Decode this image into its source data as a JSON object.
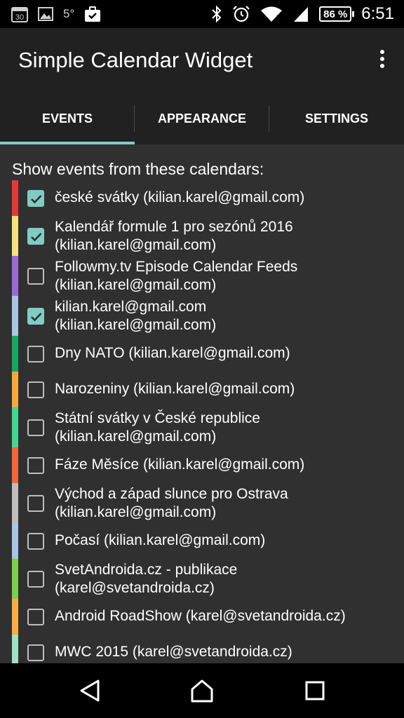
{
  "status_bar": {
    "calendar_day": "30",
    "temperature": "5°",
    "battery": "86 %",
    "time": "6:51"
  },
  "app": {
    "title": "Simple Calendar Widget"
  },
  "tabs": [
    {
      "label": "EVENTS",
      "selected": true
    },
    {
      "label": "APPEARANCE",
      "selected": false
    },
    {
      "label": "SETTINGS",
      "selected": false
    }
  ],
  "section_header": "Show events from these calendars:",
  "calendars": [
    {
      "lines": [
        "české svátky (kilian.karel@gmail.com)"
      ],
      "checked": true,
      "color": "#e53935"
    },
    {
      "lines": [
        "Kalendář formule 1 pro sezónů 2016",
        "(kilian.karel@gmail.com)"
      ],
      "checked": true,
      "color": "#f6e27a"
    },
    {
      "lines": [
        "Followmy.tv Episode Calendar Feeds",
        "(kilian.karel@gmail.com)"
      ],
      "checked": false,
      "color": "#9c6ad6"
    },
    {
      "lines": [
        "kilian.karel@gmail.com",
        "(kilian.karel@gmail.com)"
      ],
      "checked": true,
      "color": "#a9c4e4"
    },
    {
      "lines": [
        "Dny NATO (kilian.karel@gmail.com)"
      ],
      "checked": false,
      "color": "#16a765"
    },
    {
      "lines": [
        "Narozeniny (kilian.karel@gmail.com)"
      ],
      "checked": false,
      "color": "#f7a93b"
    },
    {
      "lines": [
        "Státní svátky v České republice",
        "(kilian.karel@gmail.com)"
      ],
      "checked": false,
      "color": "#42d692"
    },
    {
      "lines": [
        "Fáze Měsíce (kilian.karel@gmail.com)"
      ],
      "checked": false,
      "color": "#f4673a"
    },
    {
      "lines": [
        "Východ a západ slunce pro Ostrava",
        "(kilian.karel@gmail.com)"
      ],
      "checked": false,
      "color": "#bdbdbd"
    },
    {
      "lines": [
        "Počasí (kilian.karel@gmail.com)"
      ],
      "checked": false,
      "color": "#a9c4e4"
    },
    {
      "lines": [
        "SvetAndroida.cz - publikace",
        "(karel@svetandroida.cz)"
      ],
      "checked": false,
      "color": "#7bd148"
    },
    {
      "lines": [
        "Android RoadShow (karel@svetandroida.cz)"
      ],
      "checked": false,
      "color": "#fbac43"
    },
    {
      "lines": [
        "MWC 2015 (karel@svetandroida.cz)"
      ],
      "checked": false,
      "color": "#9fe1c1"
    }
  ],
  "colors": {
    "accent": "#80cbc4",
    "app_bar": "#212121",
    "background": "#303030"
  }
}
